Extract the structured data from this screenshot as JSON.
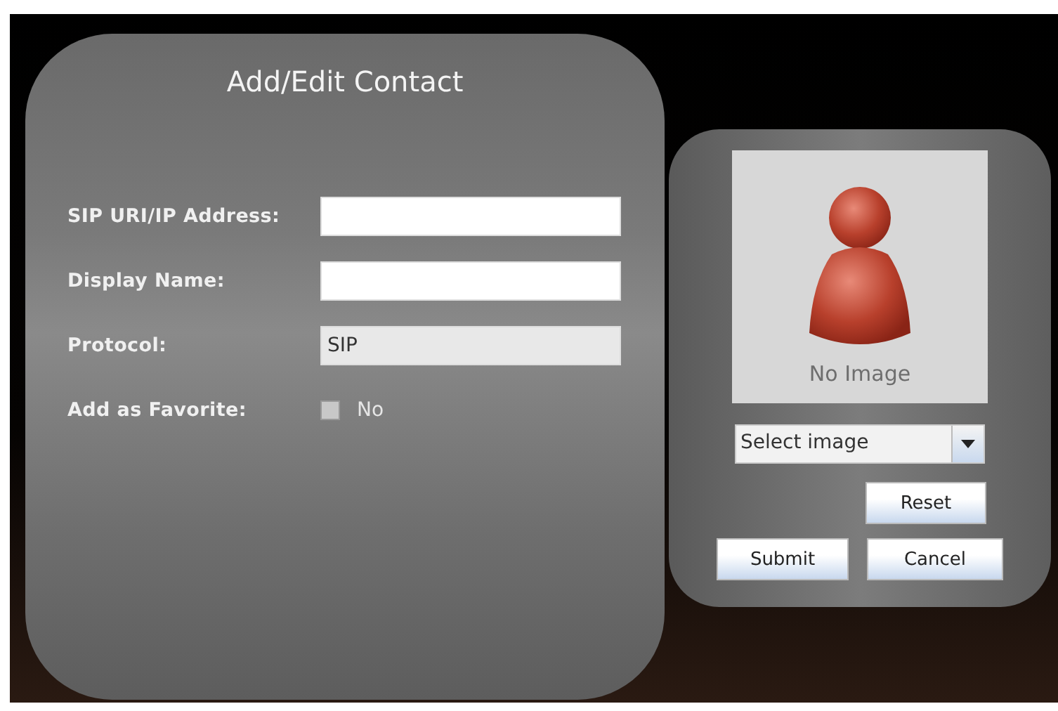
{
  "dialog": {
    "title": "Add/Edit Contact"
  },
  "fields": [
    {
      "kind": "text",
      "label": "SIP URI/IP Address:"
    },
    {
      "kind": "text",
      "label": "Display Name:"
    },
    {
      "kind": "readonly",
      "label": "Protocol:",
      "value": "SIP"
    },
    {
      "kind": "checkbox",
      "label": "Add as Favorite:",
      "checked": false,
      "caption": "No"
    }
  ],
  "image_panel": {
    "caption": "No Image",
    "select": {
      "value": "Select image"
    }
  },
  "buttons": {
    "reset": "Reset",
    "submit": "Submit",
    "cancel": "Cancel"
  }
}
